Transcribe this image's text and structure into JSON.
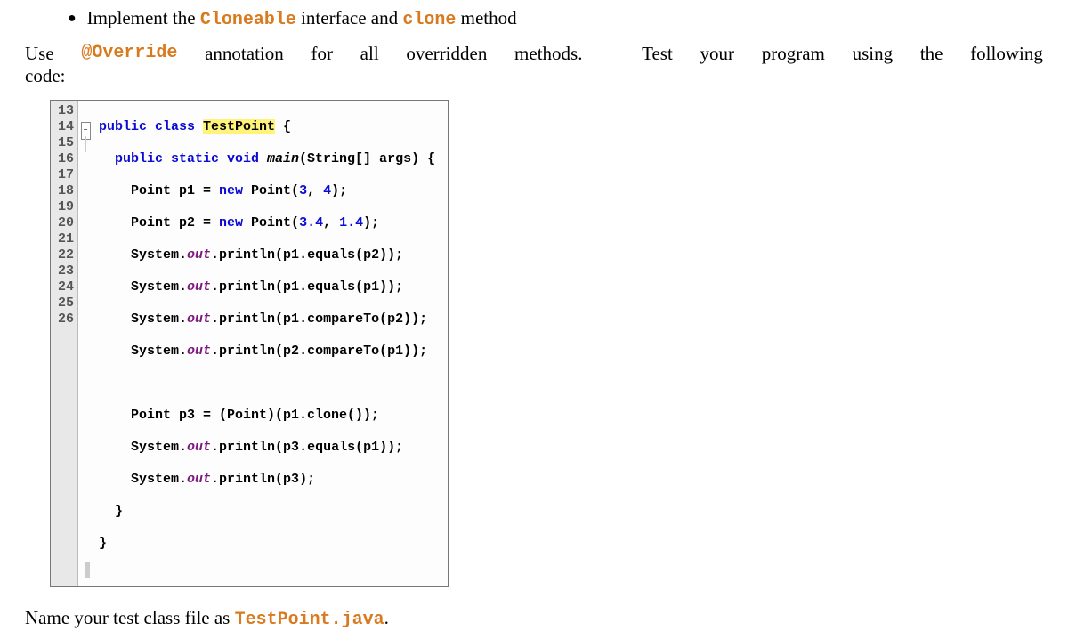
{
  "bullet": {
    "dot": "●",
    "pre": "Implement the ",
    "code1": "Cloneable",
    "mid": " interface and ",
    "code2": "clone",
    "post": " method"
  },
  "para1": {
    "w1": "Use",
    "code": "@Override",
    "w2": "annotation",
    "w3": "for",
    "w4": "all",
    "w5": "overridden",
    "w6": "methods.",
    "w7": "Test",
    "w8": "your",
    "w9": "program",
    "w10": "using",
    "w11": "the",
    "w12": "following",
    "w13": "code:"
  },
  "code": {
    "line_nums": [
      "13",
      "14",
      "15",
      "16",
      "17",
      "18",
      "19",
      "20",
      "21",
      "22",
      "23",
      "24",
      "25",
      "26"
    ],
    "l13": {
      "a": "public class ",
      "b": "TestPoint",
      "c": " {"
    },
    "l14": {
      "a": "  public static void ",
      "b": "main",
      "c": "(String[] args) {"
    },
    "l15": {
      "a": "    Point p1 = ",
      "b": "new",
      "c": " Point(",
      "d": "3",
      "e": ", ",
      "f": "4",
      "g": ");"
    },
    "l16": {
      "a": "    Point p2 = ",
      "b": "new",
      "c": " Point(",
      "d": "3.4",
      "e": ", ",
      "f": "1.4",
      "g": ");"
    },
    "l17": {
      "a": "    System.",
      "b": "out",
      "c": ".println(p1.equals(p2));"
    },
    "l18": {
      "a": "    System.",
      "b": "out",
      "c": ".println(p1.equals(p1));"
    },
    "l19": {
      "a": "    System.",
      "b": "out",
      "c": ".println(p1.compareTo(p2));"
    },
    "l20": {
      "a": "    System.",
      "b": "out",
      "c": ".println(p2.compareTo(p1));"
    },
    "l21": "",
    "l22": "    Point p3 = (Point)(p1.clone());",
    "l23": {
      "a": "    System.",
      "b": "out",
      "c": ".println(p3.equals(p1));"
    },
    "l24": {
      "a": "    System.",
      "b": "out",
      "c": ".println(p3);"
    },
    "l25": "  }",
    "l26": "}"
  },
  "closing": {
    "pre": "Name your test class file as ",
    "code": "TestPoint.java",
    "post": "."
  }
}
